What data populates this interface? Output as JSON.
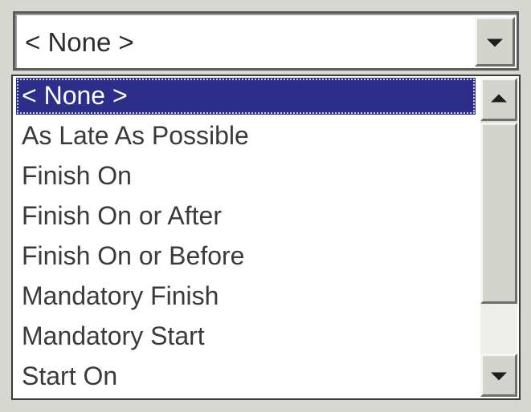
{
  "combo": {
    "value": "< None >",
    "dropdown_icon": "chevron-down-icon"
  },
  "dropdown": {
    "items": [
      {
        "label": "< None >",
        "selected": true
      },
      {
        "label": "As Late As Possible",
        "selected": false
      },
      {
        "label": "Finish On",
        "selected": false
      },
      {
        "label": "Finish On or After",
        "selected": false
      },
      {
        "label": "Finish On or Before",
        "selected": false
      },
      {
        "label": "Mandatory Finish",
        "selected": false
      },
      {
        "label": "Mandatory Start",
        "selected": false
      },
      {
        "label": "Start On",
        "selected": false
      }
    ],
    "scrollbar": {
      "up_icon": "scroll-up-arrow-icon",
      "down_icon": "scroll-down-arrow-icon"
    }
  },
  "colors": {
    "selection_background": "#2d2d8a",
    "selection_text": "#ffffff",
    "item_text": "#3a3a3a",
    "control_face": "#d4d4cf"
  }
}
